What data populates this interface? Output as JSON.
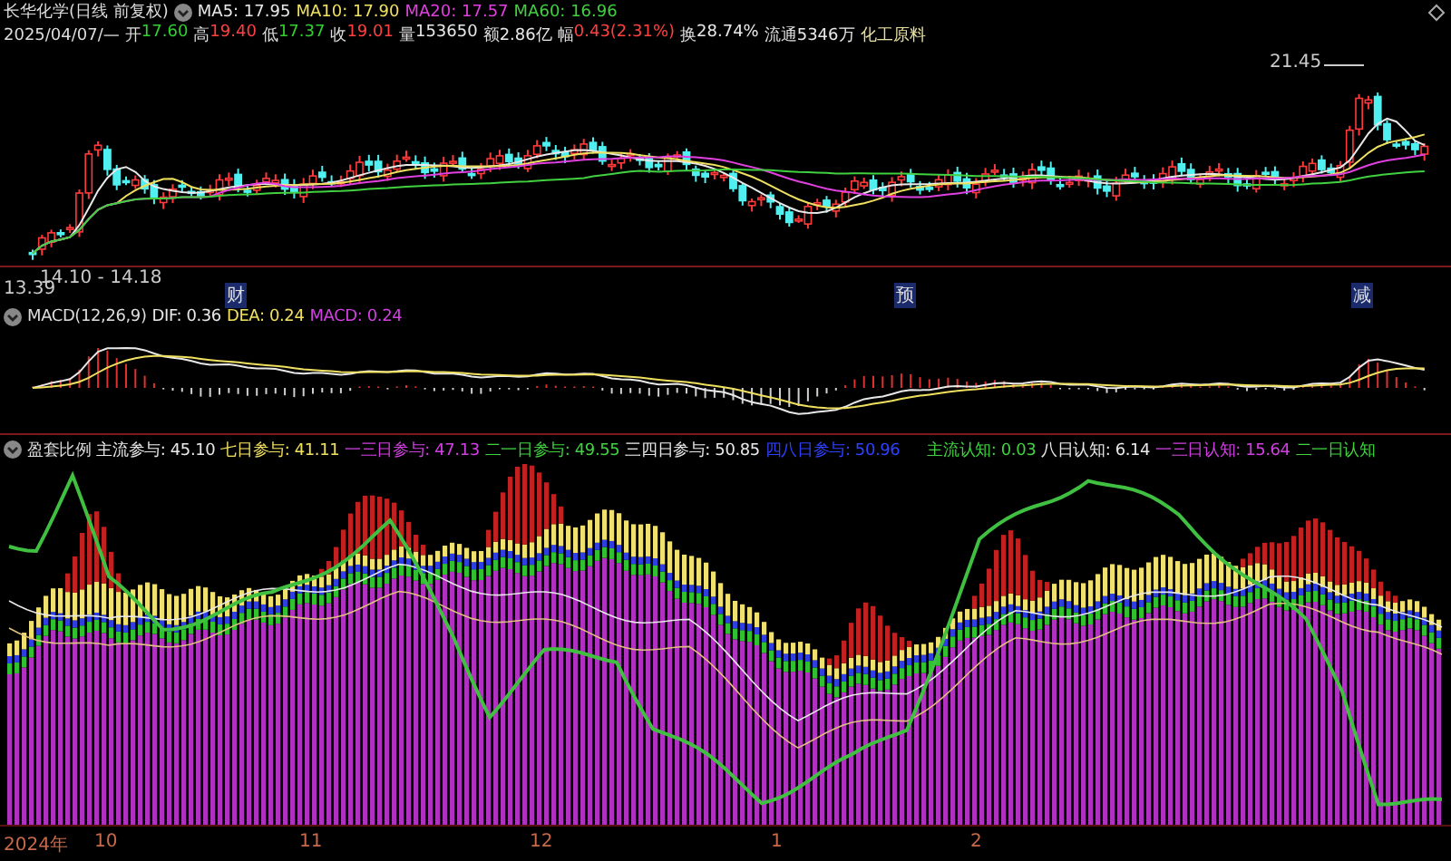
{
  "price_panel": {
    "title": "长华化学(日线 前复权)",
    "ma": [
      {
        "text": "MA5: 17.95",
        "color": "#e8e8e8"
      },
      {
        "text": "MA10: 17.90",
        "color": "#f0e060"
      },
      {
        "text": "MA20: 17.57",
        "color": "#e040e0"
      },
      {
        "text": "MA60: 16.96",
        "color": "#40d040"
      }
    ],
    "date": "2025/04/07/—",
    "quote": [
      {
        "label": "开",
        "value": "17.60",
        "color": "#30d030"
      },
      {
        "label": "高",
        "value": "19.40",
        "color": "#ff4040"
      },
      {
        "label": "低",
        "value": "17.37",
        "color": "#30d030"
      },
      {
        "label": "收",
        "value": "19.01",
        "color": "#ff4040"
      },
      {
        "label": "量",
        "value": "153650",
        "color": "#e8e8e8"
      },
      {
        "label": "额",
        "value": "2.86亿",
        "color": "#e8e8e8"
      },
      {
        "label": "幅",
        "value": "0.43(2.31%)",
        "color": "#ff4040"
      },
      {
        "label": "换",
        "value": "28.74%",
        "color": "#e8e8e8"
      },
      {
        "label": "流通",
        "value": "5346万",
        "color": "#e8e8e8"
      }
    ],
    "industry": "化工原料",
    "high_mark": "21.45",
    "range": "14.10 - 14.18",
    "low_mark": "13.39",
    "events": [
      "财",
      "预",
      "减"
    ]
  },
  "macd_panel": {
    "title": "MACD(12,26,9)",
    "readings": [
      {
        "text": "DIF: 0.36",
        "color": "#e8e8e8"
      },
      {
        "text": "DEA: 0.24",
        "color": "#f0e060"
      },
      {
        "text": "MACD: 0.24",
        "color": "#d040e0"
      }
    ]
  },
  "ratio_panel": {
    "title": "盈套比例",
    "readings": [
      {
        "text": "主流参与: 45.10",
        "color": "#e8e8e8"
      },
      {
        "text": "七日参与: 41.11",
        "color": "#f0e060"
      },
      {
        "text": "一三日参与: 47.13",
        "color": "#d040e0"
      },
      {
        "text": "二一日参与: 49.55",
        "color": "#40d040"
      },
      {
        "text": "三四日参与: 50.85",
        "color": "#e8e8e8"
      },
      {
        "text": "四八日参与: 50.96",
        "color": "#3040ff"
      },
      {
        "text": "主流认知: 0.03",
        "color": "#40d040"
      },
      {
        "text": "八日认知: 6.14",
        "color": "#e8e8e8"
      },
      {
        "text": "一三日认知: 15.64",
        "color": "#d040e0"
      },
      {
        "text": "二一日认知",
        "color": "#40d040"
      }
    ]
  },
  "time_axis": [
    "2024年",
    "10",
    "11",
    "12",
    "1",
    "2"
  ]
}
